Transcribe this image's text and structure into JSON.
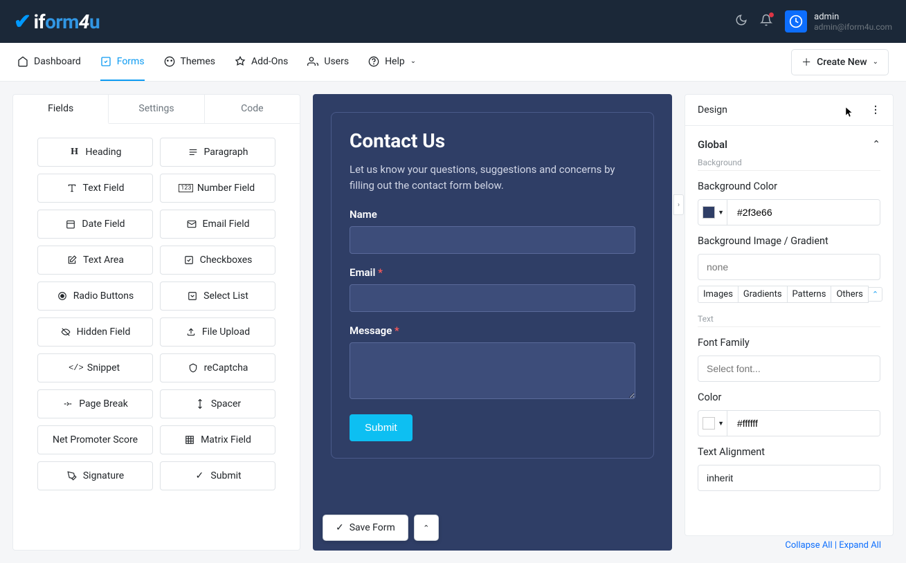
{
  "header": {
    "logo_check": "✔",
    "user_name": "admin",
    "user_email": "admin@iform4u.com"
  },
  "nav": {
    "items": [
      {
        "label": "Dashboard"
      },
      {
        "label": "Forms"
      },
      {
        "label": "Themes"
      },
      {
        "label": "Add-Ons"
      },
      {
        "label": "Users"
      },
      {
        "label": "Help"
      }
    ],
    "create_new": "Create New"
  },
  "left_panel": {
    "tabs": [
      "Fields",
      "Settings",
      "Code"
    ],
    "fields": [
      "Heading",
      "Paragraph",
      "Text Field",
      "Number Field",
      "Date Field",
      "Email Field",
      "Text Area",
      "Checkboxes",
      "Radio Buttons",
      "Select List",
      "Hidden Field",
      "File Upload",
      "Snippet",
      "reCaptcha",
      "Page Break",
      "Spacer",
      "Net Promoter Score",
      "Matrix Field",
      "Signature",
      "Submit"
    ]
  },
  "form_preview": {
    "title": "Contact Us",
    "description": "Let us know your questions, suggestions and concerns by filling out the contact form below.",
    "name_label": "Name",
    "email_label": "Email",
    "message_label": "Message",
    "required_mark": "*",
    "submit_label": "Submit",
    "save_form": "Save Form"
  },
  "right_panel": {
    "title": "Design",
    "global": "Global",
    "background_sub": "Background",
    "bg_color_label": "Background Color",
    "bg_color_value": "#2f3e66",
    "bg_image_label": "Background Image / Gradient",
    "bg_image_placeholder": "none",
    "img_tabs": [
      "Images",
      "Gradients",
      "Patterns",
      "Others"
    ],
    "text_sub": "Text",
    "font_family_label": "Font Family",
    "font_family_placeholder": "Select font...",
    "color_label": "Color",
    "color_value": "#ffffff",
    "text_align_label": "Text Alignment",
    "text_align_value": "inherit"
  },
  "footer": {
    "collapse": "Collapse All",
    "expand": "Expand All",
    "sep": " | "
  }
}
